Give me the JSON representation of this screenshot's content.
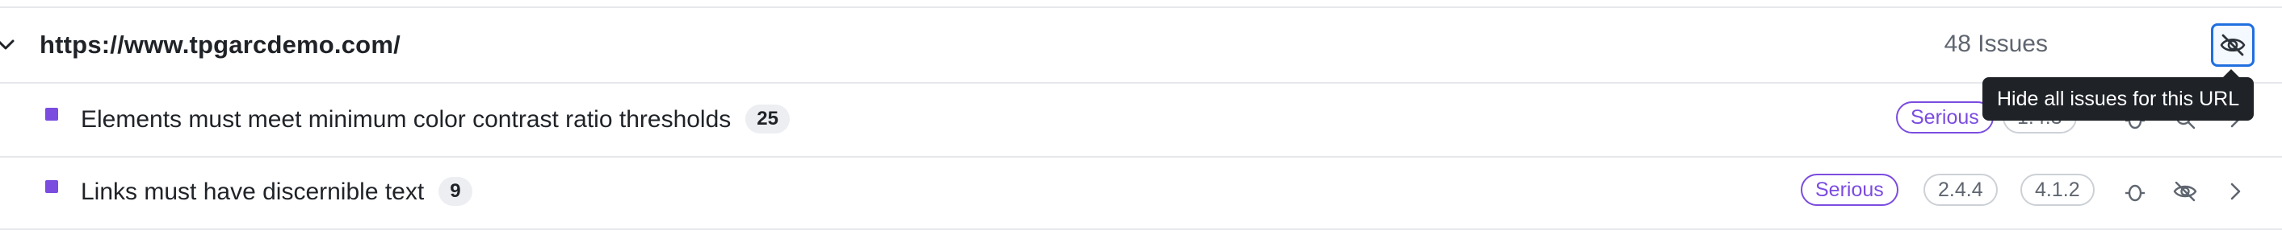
{
  "url_row": {
    "url": "https://www.tpgarcdemo.com/",
    "issues_count": "48 Issues",
    "tooltip": "Hide all issues for this URL"
  },
  "issues": [
    {
      "title": "Elements must meet minimum color contrast ratio thresholds",
      "count": "25",
      "severity": "Serious",
      "criteria": [
        "1.4.3"
      ]
    },
    {
      "title": "Links must have discernible text",
      "count": "9",
      "severity": "Serious",
      "criteria": [
        "2.4.4",
        "4.1.2"
      ]
    }
  ],
  "colors": {
    "accent_blue": "#1f6fe0",
    "severity_purple": "#7b4ce0",
    "tooltip_bg": "#1f2328"
  },
  "icons": {
    "expand": "chevron-down-icon",
    "hide": "eye-slash-icon",
    "row_actions": [
      "bug-icon",
      "search-icon",
      "eye-slash-icon",
      "chevron-right-icon"
    ]
  }
}
